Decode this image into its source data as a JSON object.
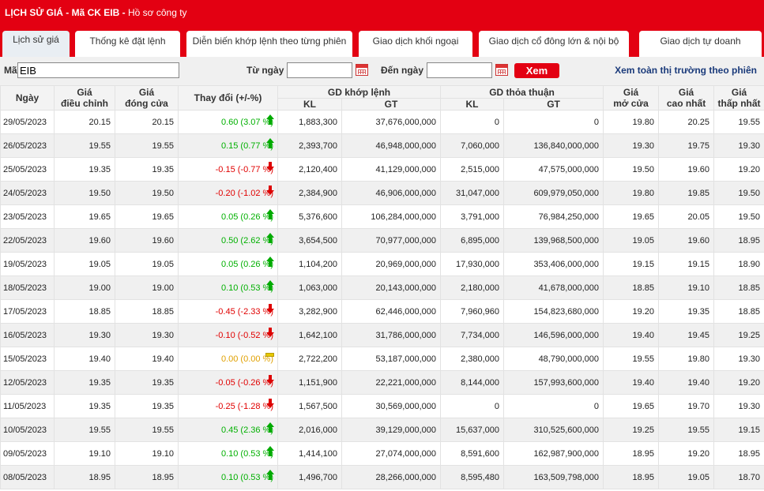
{
  "header": {
    "title_prefix": "LỊCH SỬ GIÁ - Mã CK EIB - ",
    "title_link": "Hồ sơ công ty"
  },
  "tabs": [
    "Lịch sử giá",
    "Thống kê đặt lệnh",
    "Diễn biến khớp lệnh theo từng phiên",
    "Giao dịch khối ngoại",
    "Giao dịch cổ đông lớn & nội bộ",
    "Giao dịch tự doanh"
  ],
  "filter": {
    "symbol_label": "Mã",
    "symbol_value": "EIB",
    "from_label": "Từ ngày",
    "from_value": "",
    "to_label": "Đến ngày",
    "to_value": "",
    "button_label": "Xem",
    "market_link": "Xem toàn thị trường theo phiên"
  },
  "table": {
    "headers": {
      "date": "Ngày",
      "adjusted": "Giá\nđiều chỉnh",
      "close": "Giá\nđóng cửa",
      "change": "Thay đổi (+/-%)",
      "matched": "GD khớp lệnh",
      "negotiated": "GD thỏa thuận",
      "kl": "KL",
      "gt": "GT",
      "open": "Giá\nmở cửa",
      "high": "Giá\ncao nhất",
      "low": "Giá\nthấp nhất"
    },
    "rows": [
      {
        "date": "29/05/2023",
        "adj": "20.15",
        "close": "20.15",
        "change": "0.60 (3.07 %)",
        "dir": "up",
        "kl": "1,883,300",
        "gt": "37,676,000,000",
        "tt_kl": "0",
        "tt_gt": "0",
        "open": "19.80",
        "high": "20.25",
        "low": "19.55"
      },
      {
        "date": "26/05/2023",
        "adj": "19.55",
        "close": "19.55",
        "change": "0.15 (0.77 %)",
        "dir": "up",
        "kl": "2,393,700",
        "gt": "46,948,000,000",
        "tt_kl": "7,060,000",
        "tt_gt": "136,840,000,000",
        "open": "19.30",
        "high": "19.75",
        "low": "19.30"
      },
      {
        "date": "25/05/2023",
        "adj": "19.35",
        "close": "19.35",
        "change": "-0.15 (-0.77 %)",
        "dir": "down",
        "kl": "2,120,400",
        "gt": "41,129,000,000",
        "tt_kl": "2,515,000",
        "tt_gt": "47,575,000,000",
        "open": "19.50",
        "high": "19.60",
        "low": "19.20"
      },
      {
        "date": "24/05/2023",
        "adj": "19.50",
        "close": "19.50",
        "change": "-0.20 (-1.02 %)",
        "dir": "down",
        "kl": "2,384,900",
        "gt": "46,906,000,000",
        "tt_kl": "31,047,000",
        "tt_gt": "609,979,050,000",
        "open": "19.80",
        "high": "19.85",
        "low": "19.50"
      },
      {
        "date": "23/05/2023",
        "adj": "19.65",
        "close": "19.65",
        "change": "0.05 (0.26 %)",
        "dir": "up",
        "kl": "5,376,600",
        "gt": "106,284,000,000",
        "tt_kl": "3,791,000",
        "tt_gt": "76,984,250,000",
        "open": "19.65",
        "high": "20.05",
        "low": "19.50"
      },
      {
        "date": "22/05/2023",
        "adj": "19.60",
        "close": "19.60",
        "change": "0.50 (2.62 %)",
        "dir": "up",
        "kl": "3,654,500",
        "gt": "70,977,000,000",
        "tt_kl": "6,895,000",
        "tt_gt": "139,968,500,000",
        "open": "19.05",
        "high": "19.60",
        "low": "18.95"
      },
      {
        "date": "19/05/2023",
        "adj": "19.05",
        "close": "19.05",
        "change": "0.05 (0.26 %)",
        "dir": "up",
        "kl": "1,104,200",
        "gt": "20,969,000,000",
        "tt_kl": "17,930,000",
        "tt_gt": "353,406,000,000",
        "open": "19.15",
        "high": "19.15",
        "low": "18.90"
      },
      {
        "date": "18/05/2023",
        "adj": "19.00",
        "close": "19.00",
        "change": "0.10 (0.53 %)",
        "dir": "up",
        "kl": "1,063,000",
        "gt": "20,143,000,000",
        "tt_kl": "2,180,000",
        "tt_gt": "41,678,000,000",
        "open": "18.85",
        "high": "19.10",
        "low": "18.85"
      },
      {
        "date": "17/05/2023",
        "adj": "18.85",
        "close": "18.85",
        "change": "-0.45 (-2.33 %)",
        "dir": "down",
        "kl": "3,282,900",
        "gt": "62,446,000,000",
        "tt_kl": "7,960,960",
        "tt_gt": "154,823,680,000",
        "open": "19.20",
        "high": "19.35",
        "low": "18.85"
      },
      {
        "date": "16/05/2023",
        "adj": "19.30",
        "close": "19.30",
        "change": "-0.10 (-0.52 %)",
        "dir": "down",
        "kl": "1,642,100",
        "gt": "31,786,000,000",
        "tt_kl": "7,734,000",
        "tt_gt": "146,596,000,000",
        "open": "19.40",
        "high": "19.45",
        "low": "19.25"
      },
      {
        "date": "15/05/2023",
        "adj": "19.40",
        "close": "19.40",
        "change": "0.00 (0.00 %)",
        "dir": "flat",
        "kl": "2,722,200",
        "gt": "53,187,000,000",
        "tt_kl": "2,380,000",
        "tt_gt": "48,790,000,000",
        "open": "19.55",
        "high": "19.80",
        "low": "19.30"
      },
      {
        "date": "12/05/2023",
        "adj": "19.35",
        "close": "19.35",
        "change": "-0.05 (-0.26 %)",
        "dir": "down",
        "kl": "1,151,900",
        "gt": "22,221,000,000",
        "tt_kl": "8,144,000",
        "tt_gt": "157,993,600,000",
        "open": "19.40",
        "high": "19.40",
        "low": "19.20"
      },
      {
        "date": "11/05/2023",
        "adj": "19.35",
        "close": "19.35",
        "change": "-0.25 (-1.28 %)",
        "dir": "down",
        "kl": "1,567,500",
        "gt": "30,569,000,000",
        "tt_kl": "0",
        "tt_gt": "0",
        "open": "19.65",
        "high": "19.70",
        "low": "19.30"
      },
      {
        "date": "10/05/2023",
        "adj": "19.55",
        "close": "19.55",
        "change": "0.45 (2.36 %)",
        "dir": "up",
        "kl": "2,016,000",
        "gt": "39,129,000,000",
        "tt_kl": "15,637,000",
        "tt_gt": "310,525,600,000",
        "open": "19.25",
        "high": "19.55",
        "low": "19.15"
      },
      {
        "date": "09/05/2023",
        "adj": "19.10",
        "close": "19.10",
        "change": "0.10 (0.53 %)",
        "dir": "up",
        "kl": "1,414,100",
        "gt": "27,074,000,000",
        "tt_kl": "8,591,600",
        "tt_gt": "162,987,900,000",
        "open": "18.95",
        "high": "19.20",
        "low": "18.95"
      },
      {
        "date": "08/05/2023",
        "adj": "18.95",
        "close": "18.95",
        "change": "0.10 (0.53 %)",
        "dir": "up",
        "kl": "1,496,700",
        "gt": "28,266,000,000",
        "tt_kl": "8,595,480",
        "tt_gt": "163,509,798,000",
        "open": "18.95",
        "high": "19.05",
        "low": "18.70"
      }
    ]
  },
  "colors": {
    "brand_red": "#e30012",
    "up_green": "#00b000",
    "down_red": "#e00000",
    "flat_yellow": "#e0a000",
    "link_blue": "#1a3a7a"
  }
}
